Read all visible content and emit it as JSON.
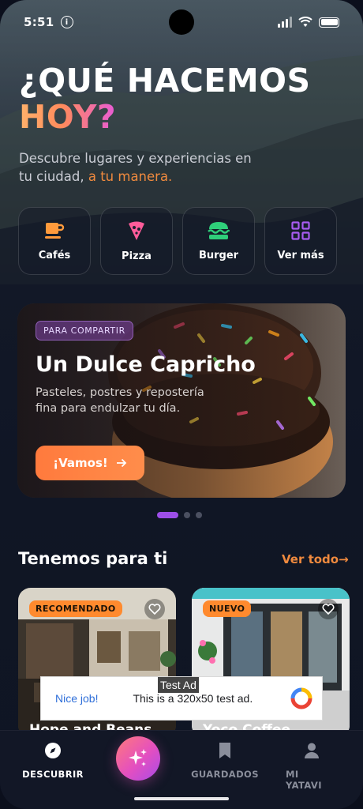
{
  "status_bar": {
    "time": "5:51",
    "info_icon": "i"
  },
  "hero": {
    "title_line1": "¿QUÉ HACEMOS",
    "title_line2": "HOY?",
    "subtitle_main": "Descubre lugares y experiencias en tu ciudad,",
    "subtitle_accent": "a tu manera."
  },
  "categories": [
    {
      "label": "Cafés",
      "icon": "coffee-icon"
    },
    {
      "label": "Pizza",
      "icon": "pizza-icon"
    },
    {
      "label": "Burger",
      "icon": "burger-icon"
    },
    {
      "label": "Ver más",
      "icon": "grid-icon"
    }
  ],
  "promo": {
    "badge": "PARA COMPARTIR",
    "title": "Un Dulce Capricho",
    "description": "Pasteles, postres y repostería fina para endulzar tu día.",
    "button_label": "¡Vamos!",
    "button_icon": "arrow-right-icon"
  },
  "carousel": {
    "pages": 3,
    "active": 1
  },
  "section": {
    "title": "Tenemos para ti",
    "see_all": "Ver todo"
  },
  "cards": [
    {
      "tag": "RECOMENDADO",
      "name": "Hope and Beans"
    },
    {
      "tag": "NUEVO",
      "name": "Yoco Coffee"
    }
  ],
  "ad": {
    "label": "Test Ad",
    "nice": "Nice job!",
    "text": "This is a 320x50 test ad."
  },
  "nav": {
    "discover": "DESCUBRIR",
    "saved": "GUARDADOS",
    "profile": "MI YATAVI"
  },
  "colors": {
    "accent_orange": "#f08a3e",
    "accent_purple": "#9d4ee8",
    "background": "#0f1523"
  }
}
